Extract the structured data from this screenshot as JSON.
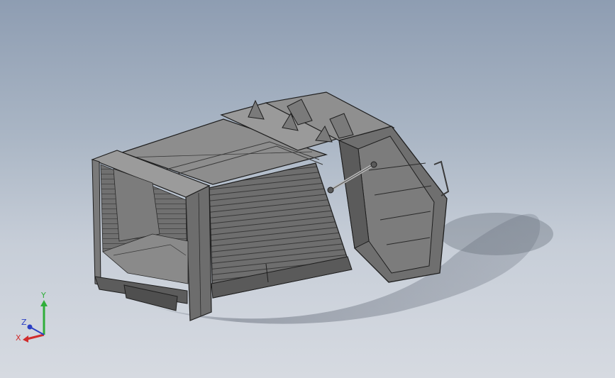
{
  "viewport": {
    "background_top": "#8e9db2",
    "background_bottom": "#d6dae1"
  },
  "triad": {
    "x_label": "X",
    "y_label": "Y",
    "z_label": "Z",
    "x_color": "#d12c2c",
    "y_color": "#2fae3a",
    "z_color": "#2b3fc4"
  },
  "model": {
    "icon": "garbage-truck-body-3d-model",
    "shade_light": "#8a8a8a",
    "shade_mid": "#6a6a6a",
    "shade_dark": "#4a4a4a",
    "edge_color": "#1e1e1e"
  }
}
